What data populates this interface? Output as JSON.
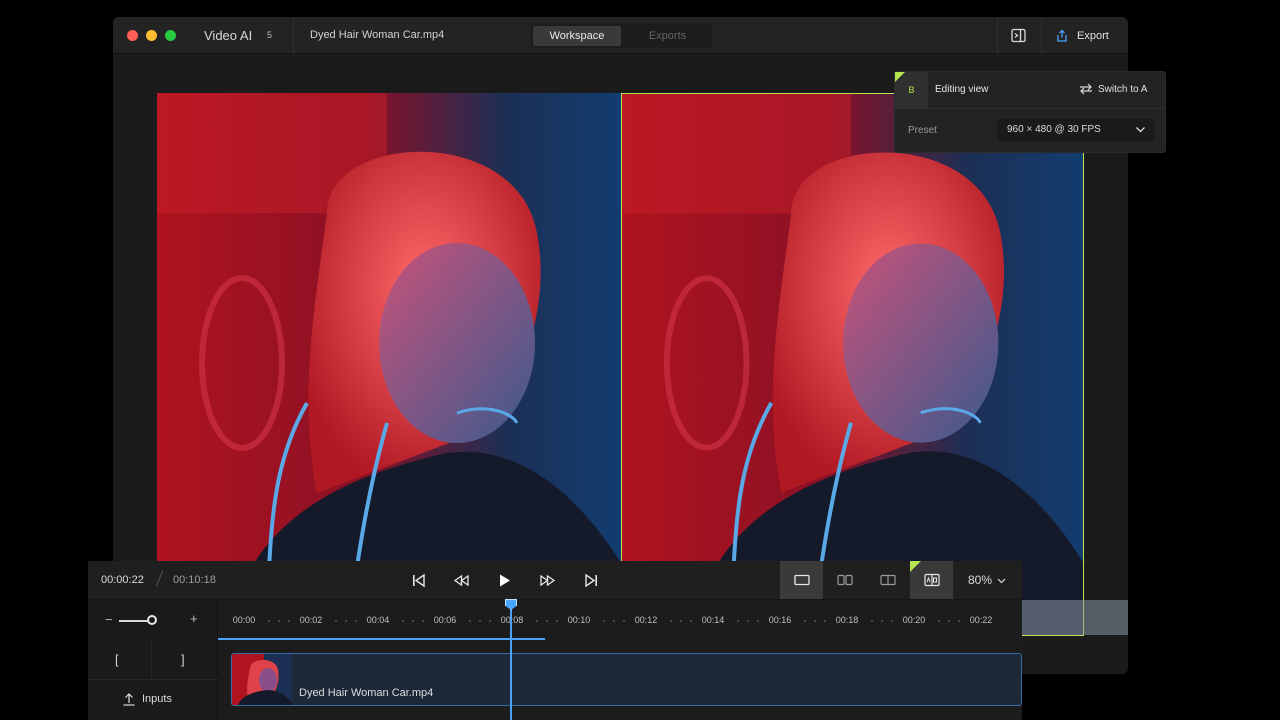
{
  "window": {
    "app_title": "Video AI",
    "app_count": "5",
    "file_title": "Dyed Hair Woman Car.mp4",
    "tabs": [
      {
        "label": "Workspace",
        "active": true
      },
      {
        "label": "Exports",
        "active": false
      }
    ],
    "sidepanel_icon": "sidebar-panel-icon",
    "export_icon": "share-export-icon",
    "export_label": "Export"
  },
  "editing_view": {
    "badge": "B",
    "title": "Editing view",
    "switch_icon": "swap-icon",
    "switch_label": "Switch to A",
    "preset_label": "Preset",
    "preset_value": "960 × 480 @ 30 FPS",
    "accent": "#b5e64f"
  },
  "playback": {
    "current_time": "00:00:22",
    "total_time": "00:10:18",
    "controls": [
      "skip-to-start-icon",
      "rewind-icon",
      "play-icon",
      "fast-forward-icon",
      "skip-to-end-icon"
    ],
    "view_modes": [
      "single-view-icon",
      "side-by-side-icon",
      "split-view-icon",
      "compare-overlay-icon"
    ],
    "zoom": "80%"
  },
  "timeline": {
    "ticks": [
      "00:00",
      "00:02",
      "00:04",
      "00:06",
      "00:08",
      "00:10",
      "00:12",
      "00:14",
      "00:16",
      "00:18",
      "00:20",
      "00:22"
    ],
    "in_point": "[",
    "out_point": "]",
    "inputs_label": "Inputs",
    "inputs_icon": "upload-icon",
    "clip_name": "Dyed Hair Woman Car.mp4",
    "playhead_color": "#4aa3ff"
  }
}
